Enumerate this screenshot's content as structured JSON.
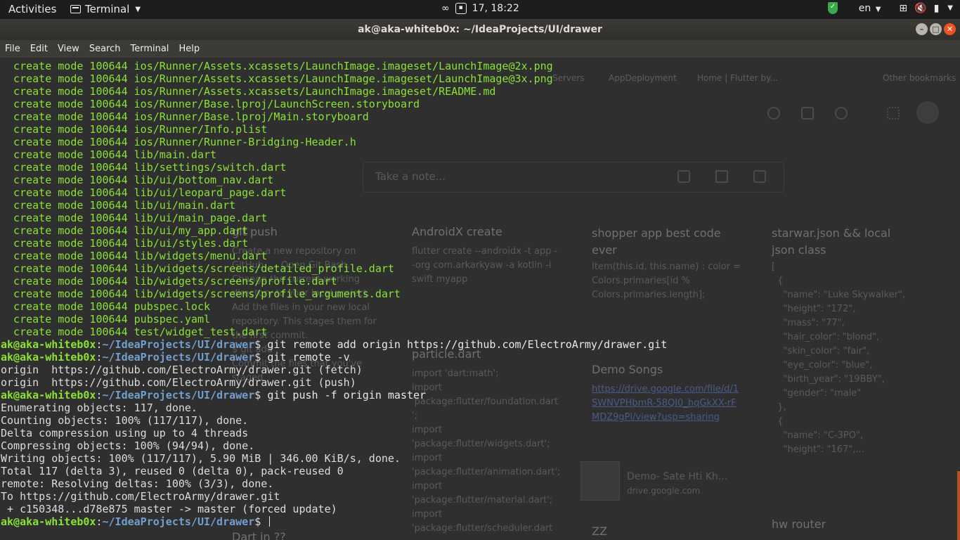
{
  "panel": {
    "activities": "Activities",
    "app_name": "Terminal",
    "datetime": "17, 18:22",
    "lang": "en"
  },
  "window": {
    "title": "ak@aka-whiteb0x: ~/IdeaProjects/UI/drawer"
  },
  "menu": [
    "File",
    "Edit",
    "View",
    "Search",
    "Terminal",
    "Help"
  ],
  "terminal": {
    "lines": [
      {
        "kind": "create",
        "text": "  create mode 100644 ios/Runner/Assets.xcassets/LaunchImage.imageset/LaunchImage@2x.png"
      },
      {
        "kind": "create",
        "text": "  create mode 100644 ios/Runner/Assets.xcassets/LaunchImage.imageset/LaunchImage@3x.png"
      },
      {
        "kind": "create",
        "text": "  create mode 100644 ios/Runner/Assets.xcassets/LaunchImage.imageset/README.md"
      },
      {
        "kind": "create",
        "text": "  create mode 100644 ios/Runner/Base.lproj/LaunchScreen.storyboard"
      },
      {
        "kind": "create",
        "text": "  create mode 100644 ios/Runner/Base.lproj/Main.storyboard"
      },
      {
        "kind": "create",
        "text": "  create mode 100644 ios/Runner/Info.plist"
      },
      {
        "kind": "create",
        "text": "  create mode 100644 ios/Runner/Runner-Bridging-Header.h"
      },
      {
        "kind": "create",
        "text": "  create mode 100644 lib/main.dart"
      },
      {
        "kind": "create",
        "text": "  create mode 100644 lib/settings/switch.dart"
      },
      {
        "kind": "create",
        "text": "  create mode 100644 lib/ui/bottom_nav.dart"
      },
      {
        "kind": "create",
        "text": "  create mode 100644 lib/ui/leopard_page.dart"
      },
      {
        "kind": "create",
        "text": "  create mode 100644 lib/ui/main.dart"
      },
      {
        "kind": "create",
        "text": "  create mode 100644 lib/ui/main_page.dart"
      },
      {
        "kind": "create",
        "text": "  create mode 100644 lib/ui/my_app.dart"
      },
      {
        "kind": "create",
        "text": "  create mode 100644 lib/ui/styles.dart"
      },
      {
        "kind": "create",
        "text": "  create mode 100644 lib/widgets/menu.dart"
      },
      {
        "kind": "create",
        "text": "  create mode 100644 lib/widgets/screens/detailed_profile.dart"
      },
      {
        "kind": "create",
        "text": "  create mode 100644 lib/widgets/screens/profile.dart"
      },
      {
        "kind": "create",
        "text": "  create mode 100644 lib/widgets/screens/profile_arguments.dart"
      },
      {
        "kind": "create",
        "text": "  create mode 100644 pubspec.lock"
      },
      {
        "kind": "create",
        "text": "  create mode 100644 pubspec.yaml"
      },
      {
        "kind": "create",
        "text": "  create mode 100644 test/widget_test.dart"
      },
      {
        "kind": "prompt",
        "user": "ak@aka-whiteb0x",
        "sep": ":",
        "path": "~/IdeaProjects/UI/drawer",
        "sym": "$ ",
        "cmd": "git remote add origin https://github.com/ElectroArmy/drawer.git"
      },
      {
        "kind": "prompt",
        "user": "ak@aka-whiteb0x",
        "sep": ":",
        "path": "~/IdeaProjects/UI/drawer",
        "sym": "$ ",
        "cmd": "git remote -v"
      },
      {
        "kind": "out",
        "text": "origin  https://github.com/ElectroArmy/drawer.git (fetch)"
      },
      {
        "kind": "out",
        "text": "origin  https://github.com/ElectroArmy/drawer.git (push)"
      },
      {
        "kind": "prompt",
        "user": "ak@aka-whiteb0x",
        "sep": ":",
        "path": "~/IdeaProjects/UI/drawer",
        "sym": "$ ",
        "cmd": "git push -f origin master"
      },
      {
        "kind": "out",
        "text": "Enumerating objects: 117, done."
      },
      {
        "kind": "out",
        "text": "Counting objects: 100% (117/117), done."
      },
      {
        "kind": "out",
        "text": "Delta compression using up to 4 threads"
      },
      {
        "kind": "out",
        "text": "Compressing objects: 100% (94/94), done."
      },
      {
        "kind": "out",
        "text": "Writing objects: 100% (117/117), 5.90 MiB | 346.00 KiB/s, done."
      },
      {
        "kind": "out",
        "text": "Total 117 (delta 3), reused 0 (delta 0), pack-reused 0"
      },
      {
        "kind": "out",
        "text": "remote: Resolving deltas: 100% (3/3), done."
      },
      {
        "kind": "out",
        "text": "To https://github.com/ElectroArmy/drawer.git"
      },
      {
        "kind": "out",
        "text": " + c150348...d78e875 master -> master (forced update)"
      },
      {
        "kind": "prompt",
        "user": "ak@aka-whiteb0x",
        "sep": ":",
        "path": "~/IdeaProjects/UI/drawer",
        "sym": "$ ",
        "cmd": ""
      }
    ]
  },
  "background": {
    "bookmarks": [
      "Servers",
      "AppDeployment",
      "Home | Flutter by...",
      "Other bookmarks"
    ],
    "note_placeholder": "Take a note...",
    "cards": [
      {
        "title": "AndroidX create",
        "body": "flutter create --androidx -t app --org com.arkarkyaw -a kotlin -i swift myapp"
      },
      {
        "title": "shopper app best code ever",
        "body": "Item(this.id, this.name) : color = Colors.primaries[id % Colors.primaries.length];"
      },
      {
        "title": "starwar.json && local json class",
        "body": "[\n  {\n    \"name\": \"Luke Skywalker\",\n    \"height\": \"172\",\n    \"mass\": \"77\",\n    \"hair_color\": \"blond\",\n    \"skin_color\": \"fair\",\n    \"eye_color\": \"blue\",\n    \"birth_year\": \"19BBY\",\n    \"gender\": \"male\"\n  },\n  {\n    \"name\": \"C-3PO\",\n    \"height\": \"167\",..."
      },
      {
        "title": "particle.dart",
        "body": "import 'dart:math';\nimport\n'package:flutter/foundation.dart\n';\nimport\n'package:flutter/widgets.dart';\nimport\n'package:flutter/animation.dart';\nimport\n'package:flutter/material.dart';\nimport\n'package:flutter/scheduler.dart"
      },
      {
        "title": "Demo Songs",
        "body": "https://drive.google.com/file/d/1SWNVPHbmR-58QI0_hqGkXX-rFMDZ9gPl/view?usp=sharing"
      },
      {
        "title": "Demo- Sate Hti Kh...",
        "body": "drive.google.com"
      },
      {
        "title": "ZZ",
        "body": ""
      },
      {
        "title": "hw router",
        "body": ""
      },
      {
        "title": "Dart in ??",
        "body": ""
      },
      {
        "title": "git push",
        "body": "Create a new repository on GitHub. ... Open Git Bash.\nChange the current working directory to your local project.\nAdd the files in your new local repository. This stages them for the first commit.\n$ git add .\nCommit the files that you've staged"
      }
    ]
  },
  "colors": {
    "prompt_user": "#8ae234",
    "prompt_path": "#729fcf",
    "close_button": "#e95420"
  }
}
